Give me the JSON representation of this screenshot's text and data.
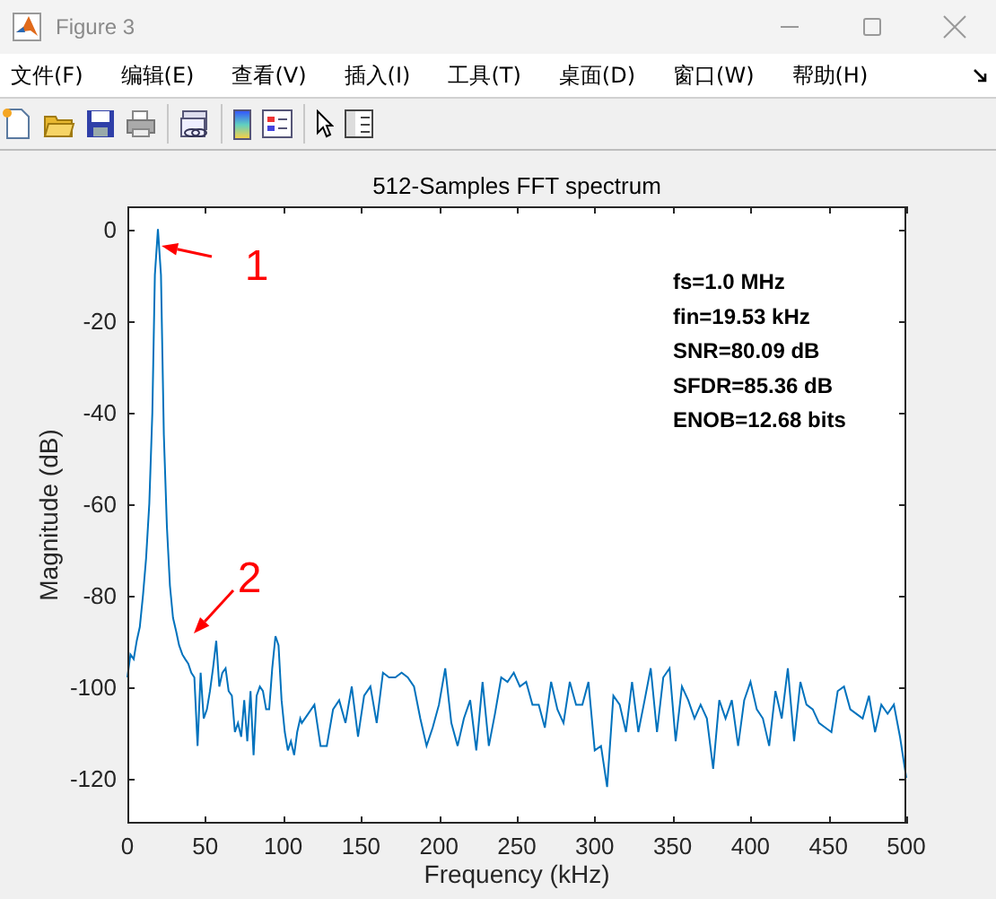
{
  "window": {
    "title": "Figure 3"
  },
  "menu": [
    "文件(F)",
    "编辑(E)",
    "查看(V)",
    "插入(I)",
    "工具(T)",
    "桌面(D)",
    "窗口(W)",
    "帮助(H)"
  ],
  "figure": {
    "info_lines": [
      "fs=1.0 MHz",
      "fin=19.53 kHz",
      "SNR=80.09 dB",
      "SFDR=85.36 dB",
      "ENOB=12.68 bits"
    ],
    "chart_data": {
      "type": "line",
      "title": "512-Samples FFT spectrum",
      "xlabel": "Frequency (kHz)",
      "ylabel": "Magnitude (dB)",
      "xlim": [
        0,
        500
      ],
      "ylim": [
        -130,
        5
      ],
      "xticks": [
        0,
        50,
        100,
        150,
        200,
        250,
        300,
        350,
        400,
        450,
        500
      ],
      "yticks": [
        -120,
        -100,
        -80,
        -60,
        -40,
        -20,
        0
      ],
      "x": [
        0,
        2,
        4,
        6,
        8,
        10,
        12,
        14,
        16,
        17.6,
        19.53,
        21.5,
        23.4,
        25.4,
        27.3,
        29.3,
        31.3,
        33.2,
        35.2,
        37.1,
        39,
        41,
        43,
        45,
        47,
        49,
        51,
        53,
        55,
        57,
        59,
        61,
        63,
        65,
        67,
        69,
        71,
        73,
        75,
        77,
        79,
        81,
        83,
        85,
        87,
        89,
        91,
        93,
        95,
        97,
        99,
        101,
        103,
        105,
        107,
        109,
        111,
        112,
        116,
        120,
        124,
        128,
        132,
        136,
        140,
        144,
        148,
        152,
        156,
        160,
        164,
        168,
        172,
        176,
        180,
        184,
        188,
        192,
        196,
        200,
        204,
        208,
        212,
        216,
        220,
        224,
        228,
        232,
        236,
        240,
        244,
        248,
        252,
        256,
        260,
        264,
        268,
        272,
        276,
        280,
        284,
        288,
        292,
        296,
        300,
        304,
        308,
        312,
        316,
        320,
        324,
        328,
        332,
        336,
        340,
        344,
        348,
        352,
        356,
        360,
        364,
        368,
        372,
        376,
        380,
        384,
        388,
        392,
        396,
        400,
        404,
        408,
        412,
        416,
        420,
        424,
        428,
        432,
        436,
        440,
        444,
        448,
        452,
        456,
        460,
        464,
        468,
        472,
        476,
        480,
        484,
        488,
        492,
        496,
        500
      ],
      "series": [
        {
          "color": "#0072bd",
          "values": [
            -98,
            -93,
            -94,
            -90,
            -87,
            -80,
            -72,
            -60,
            -40,
            -10,
            0,
            -10,
            -45,
            -65,
            -78,
            -85,
            -88,
            -91,
            -93,
            -94,
            -95,
            -97,
            -98,
            -113,
            -97,
            -107,
            -105,
            -101,
            -96,
            -90,
            -100,
            -97,
            -96,
            -101,
            -102,
            -110,
            -108,
            -111,
            -103,
            -112,
            -101,
            -115,
            -102,
            -100,
            -101,
            -105,
            -105,
            -96,
            -89,
            -91,
            -103,
            -110,
            -114,
            -112,
            -115,
            -110,
            -107,
            -108,
            -106,
            -104,
            -113,
            -113,
            -105,
            -103,
            -108,
            -100,
            -111,
            -102,
            -100,
            -108,
            -97,
            -98,
            -98,
            -97,
            -98,
            -100,
            -107,
            -113,
            -109,
            -104,
            -96,
            -108,
            -113,
            -107,
            -103,
            -114,
            -99,
            -113,
            -106,
            -98,
            -99,
            -97,
            -100,
            -99,
            -104,
            -104,
            -109,
            -99,
            -105,
            -108,
            -99,
            -104,
            -104,
            -99,
            -114,
            -113,
            -122,
            -102,
            -104,
            -110,
            -99,
            -110,
            -103,
            -96,
            -110,
            -98,
            -96,
            -112,
            -100,
            -103,
            -107,
            -104,
            -107,
            -118,
            -103,
            -107,
            -103,
            -113,
            -103,
            -99,
            -105,
            -107,
            -113,
            -101,
            -107,
            -96,
            -112,
            -99,
            -104,
            -105,
            -108,
            -109,
            -110,
            -101,
            -100,
            -105,
            -106,
            -107,
            -102,
            -110,
            -104,
            -106,
            -104,
            -111,
            -120
          ]
        }
      ],
      "annotations": [
        "1",
        "2"
      ]
    }
  }
}
